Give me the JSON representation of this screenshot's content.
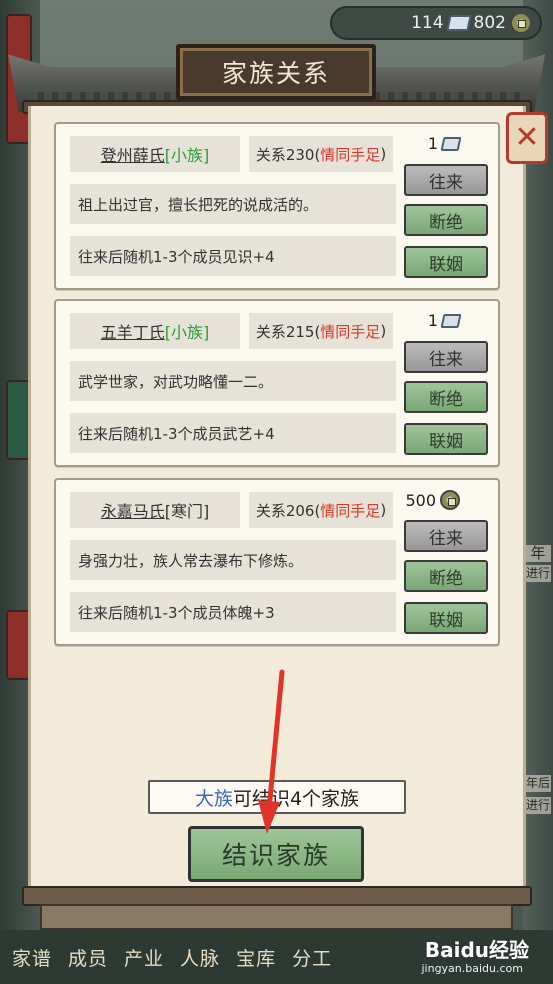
{
  "currency": {
    "scrolls": "114",
    "coins": "802"
  },
  "title": "家族关系",
  "families": [
    {
      "name": "登州薛氏",
      "tag": "[小族]",
      "relation": "关系230(",
      "tier": "情同手足",
      "close": ")",
      "cost": "1",
      "cost_type": "scroll-icon",
      "description": "祖上出过官，擅长把死的说成活的。",
      "effect": "往来后随机1-3个成员见识+4",
      "btn_visit": "往来",
      "btn_break": "断绝",
      "btn_marry": "联姻"
    },
    {
      "name": "五羊丁氏",
      "tag": "[小族]",
      "relation": "关系215(",
      "tier": "情同手足",
      "close": ")",
      "cost": "1",
      "cost_type": "scroll-icon",
      "description": "武学世家，对武功略懂一二。",
      "effect": "往来后随机1-3个成员武艺+4",
      "btn_visit": "往来",
      "btn_break": "断绝",
      "btn_marry": "联姻"
    },
    {
      "name": "永嘉马氏",
      "tag": "[寒门]",
      "relation": "关系206(",
      "tier": "情同手足",
      "close": ")",
      "cost": "500",
      "cost_type": "coin-icon",
      "description": "身强力壮，族人常去瀑布下修炼。",
      "effect": "往来后随机1-3个成员体魄+3",
      "btn_visit": "往来",
      "btn_break": "断绝",
      "btn_marry": "联姻"
    }
  ],
  "info": {
    "highlight": "大族",
    "text": "可结识4个家族"
  },
  "main_button": "结识家族",
  "bottom_nav": [
    "家谱",
    "成员",
    "产业",
    "人脉",
    "宝库",
    "分工"
  ],
  "side_text": {
    "right1": "年",
    "right2": "进行",
    "right3": "年后",
    "right4": "进行"
  },
  "watermark": {
    "brand": "Baidu经验",
    "url": "jingyan.baidu.com"
  },
  "colors": {
    "tag_green": "#2f9a3a",
    "tier_red": "#d63a2a",
    "button_green": "#8fb88a",
    "button_gray": "#aaaaaa",
    "highlight_blue": "#3968c4",
    "arrow_red": "#e0342a"
  }
}
